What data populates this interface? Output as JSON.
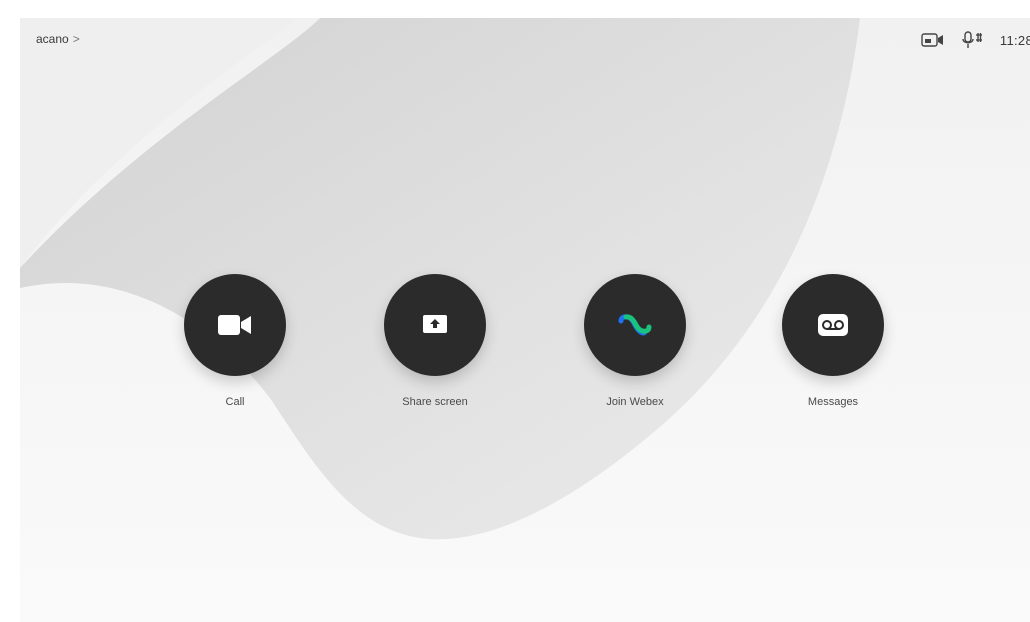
{
  "header": {
    "device_name": "acano",
    "chevron": ">",
    "time": "11:28",
    "icons": [
      "camera-self-view-icon",
      "microphone-icon"
    ]
  },
  "actions": [
    {
      "label": "Call",
      "icon": "video-camera-icon"
    },
    {
      "label": "Share screen",
      "icon": "share-screen-icon"
    },
    {
      "label": "Join Webex",
      "icon": "webex-logo-icon"
    },
    {
      "label": "Messages",
      "icon": "voicemail-icon"
    }
  ],
  "colors": {
    "button_bg": "#2b2b2b",
    "background_light": "#f4f4f4",
    "background_shape": "#dcdcdc",
    "webex_blue": "#1d73f2",
    "webex_green": "#19c37d"
  }
}
